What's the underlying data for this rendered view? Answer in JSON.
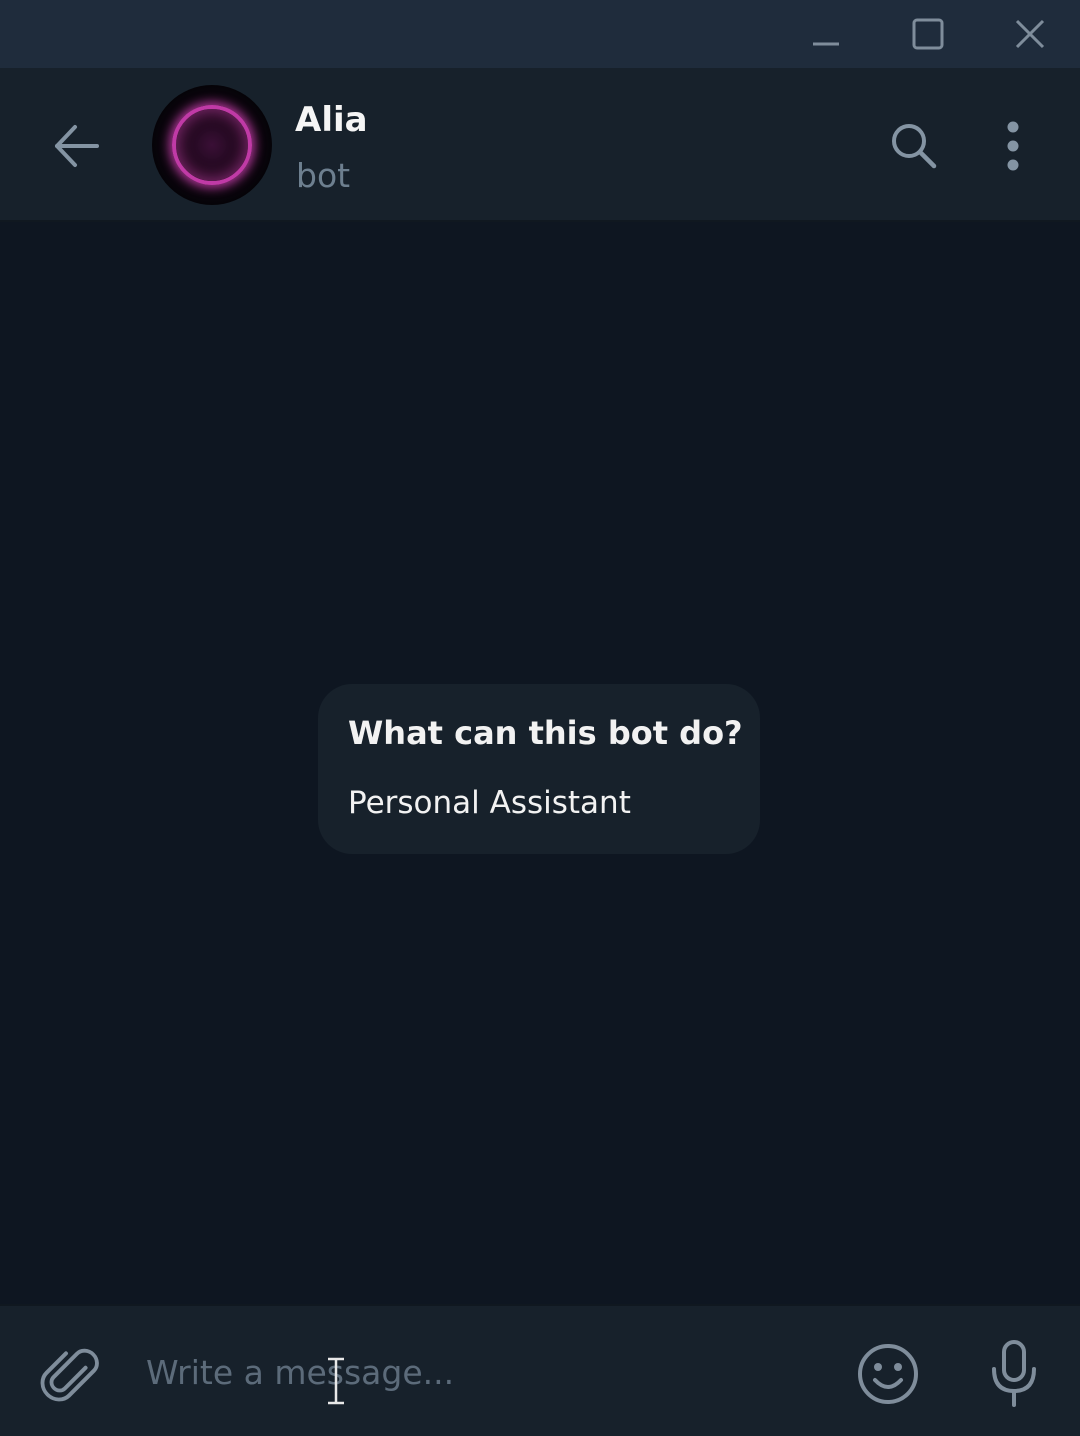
{
  "window": {
    "buttons": {
      "minimize_icon": "minimize-icon",
      "maximize_icon": "maximize-icon",
      "close_icon": "close-icon"
    }
  },
  "header": {
    "name": "Alia",
    "status": "bot",
    "icons": {
      "back": "arrow-left-icon",
      "search": "search-icon",
      "more": "more-vertical-icon"
    },
    "avatar_accent": "#c03aa6"
  },
  "chat": {
    "bot_info": {
      "title": "What can this bot do?",
      "description": "Personal Assistant"
    }
  },
  "composer": {
    "placeholder": "Write a message...",
    "value": "",
    "icons": {
      "attach": "paperclip-icon",
      "emoji": "smiley-icon",
      "voice": "microphone-icon"
    }
  },
  "colors": {
    "background": "#0e1621",
    "panel": "#17212b",
    "titlebar": "#1f2c3c",
    "text_primary": "#f5f5f5",
    "text_secondary": "#6d7f8f",
    "icon": "#7f8d9b"
  }
}
